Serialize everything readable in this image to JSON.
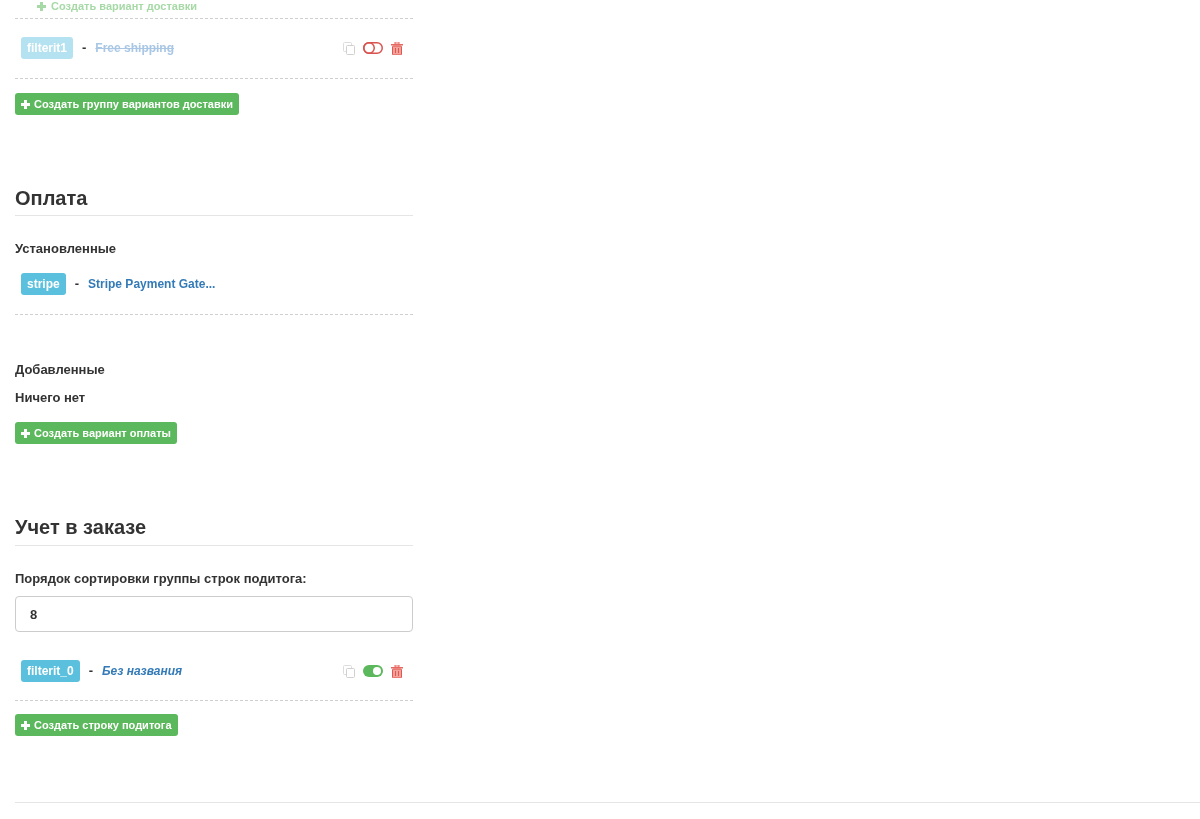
{
  "shipping": {
    "add_option_link": {
      "label": "Создать вариант доставки",
      "disabled": true
    },
    "groups": [
      {
        "code": "filterit1",
        "separator": "-",
        "name": "Free shipping",
        "enabled": false
      }
    ],
    "create_group_button": "Создать группу вариантов доставки"
  },
  "payment": {
    "title": "Оплата",
    "installed": {
      "title": "Установленные",
      "items": [
        {
          "code": "stripe",
          "separator": "-",
          "name": "Stripe Payment Gate..."
        }
      ]
    },
    "added": {
      "title": "Добавленные",
      "empty_text": "Ничего нет"
    },
    "create_button": "Создать вариант оплаты"
  },
  "order_totals": {
    "title": "Учет в заказе",
    "sort_order": {
      "label": "Порядок сортировки группы строк подитога:",
      "value": "8"
    },
    "rows": [
      {
        "code": "filterit_0",
        "separator": "-",
        "name": "Без названия",
        "enabled": true
      }
    ],
    "create_button": "Создать строку подитога"
  }
}
